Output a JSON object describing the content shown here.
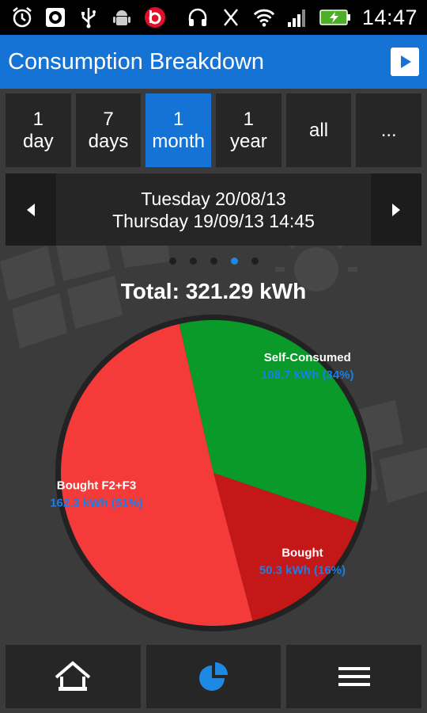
{
  "status_bar": {
    "icons": [
      "alarm-icon",
      "media-icon",
      "usb-icon",
      "android-icon",
      "beats-icon",
      "headset-icon",
      "no-vibrate-icon",
      "wifi-icon",
      "signal-icon",
      "battery-charging-icon"
    ],
    "time": "14:47"
  },
  "header": {
    "title": "Consumption Breakdown",
    "action_icon": "play-icon"
  },
  "range_tabs": [
    {
      "label": "1\nday",
      "active": false
    },
    {
      "label": "7\ndays",
      "active": false
    },
    {
      "label": "1\nmonth",
      "active": true
    },
    {
      "label": "1\nyear",
      "active": false
    },
    {
      "label": "all",
      "active": false
    },
    {
      "label": "...",
      "active": false
    }
  ],
  "date_range": {
    "start": "Tuesday 20/08/13",
    "end": "Thursday 19/09/13 14:45"
  },
  "pager": {
    "count": 5,
    "active_index": 3
  },
  "total": "Total: 321.29 kWh",
  "chart_data": {
    "type": "pie",
    "title": "Total: 321.29 kWh",
    "slices": [
      {
        "name": "Self-Consumed",
        "value": 108.7,
        "unit": "kWh",
        "percent": 34,
        "label_value": "108.7 kWh (34%)",
        "color": "#0a9a2a"
      },
      {
        "name": "Bought",
        "value": 50.3,
        "unit": "kWh",
        "percent": 16,
        "label_value": "50.3 kWh (16%)",
        "color": "#c41818"
      },
      {
        "name": "Bought F2+F3",
        "value": 162.3,
        "unit": "kWh",
        "percent": 51,
        "label_value": "162.3 kWh (51%)",
        "color": "#f53a3a"
      }
    ],
    "value_label_color": "#1a7ee6"
  },
  "bottom_nav": [
    {
      "icon": "home-icon"
    },
    {
      "icon": "pie-chart-icon"
    },
    {
      "icon": "menu-icon"
    }
  ],
  "colors": {
    "accent": "#1673d6",
    "background": "#3b3b3b",
    "panel": "#262626"
  }
}
